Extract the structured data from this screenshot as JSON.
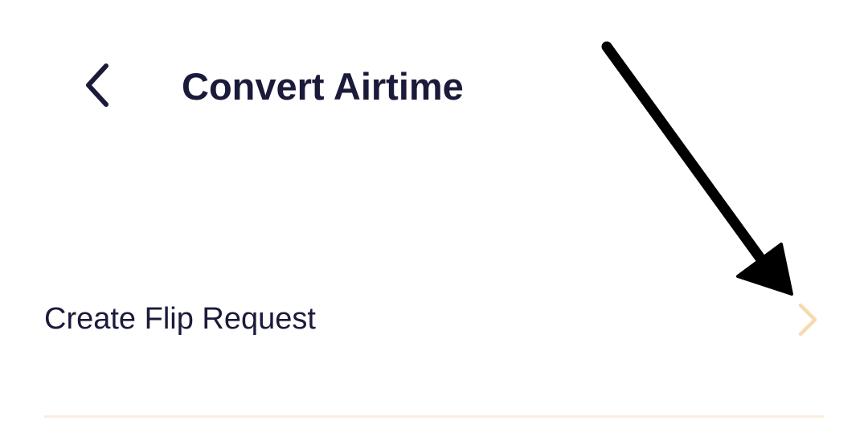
{
  "header": {
    "back_icon": "chevron-left-icon",
    "title": "Convert Airtime"
  },
  "menu": {
    "items": [
      {
        "label": "Create Flip Request",
        "icon": "chevron-right-icon"
      }
    ]
  },
  "colors": {
    "text": "#1a1a3a",
    "accent_chevron": "#f8d9b0",
    "divider": "#fbeedd",
    "annotation_arrow": "#000000"
  }
}
